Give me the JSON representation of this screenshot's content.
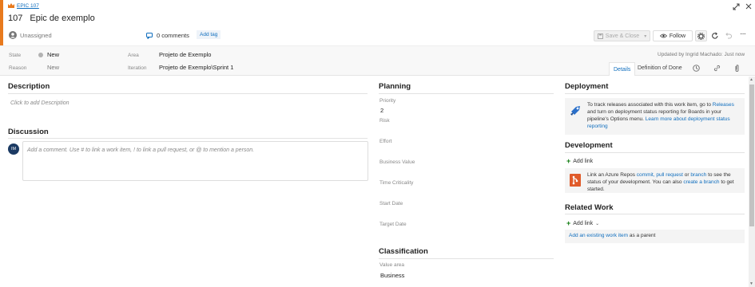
{
  "header": {
    "breadcrumb": "EPIC 107",
    "item_id": "107",
    "title": "Epic de exemplo",
    "assignee": "Unassigned",
    "comments_count": "0 comments",
    "add_tag": "Add tag",
    "save_close": "Save & Close",
    "follow": "Follow",
    "updated": "Updated by Ingrid Machado: Just now"
  },
  "fields": {
    "state_label": "State",
    "state_value": "New",
    "reason_label": "Reason",
    "reason_value": "New",
    "area_label": "Area",
    "area_value": "Projeto de Exemplo",
    "iteration_label": "Iteration",
    "iteration_value": "Projeto de Exemplo\\Sprint 1"
  },
  "tabs": {
    "details": "Details",
    "definition_of_done": "Definition of Done"
  },
  "description": {
    "title": "Description",
    "placeholder": "Click to add Description"
  },
  "discussion": {
    "title": "Discussion",
    "avatar_initials": "IM",
    "placeholder": "Add a comment. Use # to link a work item, ! to link a pull request, or @ to mention a person."
  },
  "planning": {
    "title": "Planning",
    "priority_label": "Priority",
    "priority_value": "2",
    "risk_label": "Risk",
    "effort_label": "Effort",
    "business_value_label": "Business Value",
    "time_criticality_label": "Time Criticality",
    "start_date_label": "Start Date",
    "target_date_label": "Target Date"
  },
  "classification": {
    "title": "Classification",
    "value_area_label": "Value area",
    "value_area_value": "Business"
  },
  "deployment": {
    "title": "Deployment",
    "text1": "To track releases associated with this work item, go to",
    "link_releases": "Releases",
    "text2": "and turn on deployment status reporting for Boards in your pipeline's Options menu.",
    "link_learn": "Learn more about deployment status reporting"
  },
  "development": {
    "title": "Development",
    "add_link": "Add link",
    "text1": "Link an Azure Repos",
    "link_commit": "commit,",
    "link_pr": "pull request",
    "text_or": "or",
    "link_branch": "branch",
    "text2": "to see the status of your development. You can also",
    "link_create_branch": "create a branch",
    "text3": "to get started."
  },
  "related_work": {
    "title": "Related Work",
    "add_link": "Add link",
    "existing_link": "Add an existing work item",
    "existing_suffix": "as a parent"
  },
  "colors": {
    "accent": "#e87a1d",
    "link": "#106ebe",
    "new_state": "#b2b2b2"
  }
}
